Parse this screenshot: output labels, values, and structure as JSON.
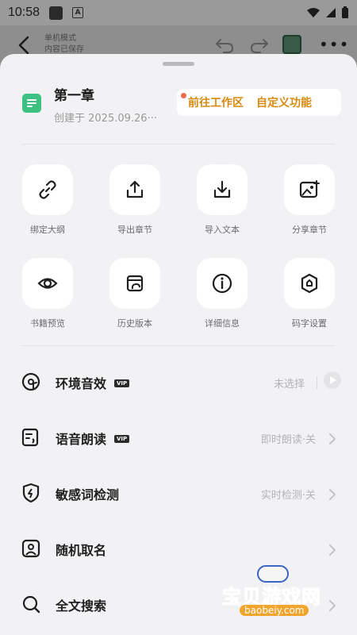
{
  "status_bar": {
    "time": "10:58",
    "a_badge": "A"
  },
  "editor": {
    "save_state_line1": "单机模式",
    "save_state_line2": "内容已保存"
  },
  "document": {
    "title": "第一章",
    "created": "创建于 2025.09.26···"
  },
  "header_actions": {
    "go_workspace": "前往工作区",
    "customize": "自定义功能"
  },
  "grid": [
    {
      "label": "绑定大纲",
      "icon": "link-icon"
    },
    {
      "label": "导出章节",
      "icon": "export-icon"
    },
    {
      "label": "导入文本",
      "icon": "import-icon"
    },
    {
      "label": "分享章节",
      "icon": "share-image-icon"
    },
    {
      "label": "书籍预览",
      "icon": "eye-icon"
    },
    {
      "label": "历史版本",
      "icon": "history-icon"
    },
    {
      "label": "详细信息",
      "icon": "info-icon"
    },
    {
      "label": "码字设置",
      "icon": "settings-hex-icon"
    }
  ],
  "settings": [
    {
      "label": "环境音效",
      "vip": "VIP",
      "value": "未选择"
    },
    {
      "label": "语音朗读",
      "vip": "VIP",
      "value": "即时朗读·关"
    },
    {
      "label": "敏感词检测",
      "value": "实时检测·关"
    },
    {
      "label": "随机取名",
      "value": ""
    },
    {
      "label": "全文搜索",
      "value": ""
    }
  ],
  "watermark": {
    "title": "宝贝游戏网",
    "url": "baobeiy.com"
  },
  "colors": {
    "accent_green": "#3cc07f",
    "action_orange": "#d88a10",
    "sheet_bg": "#f2f2f4"
  }
}
